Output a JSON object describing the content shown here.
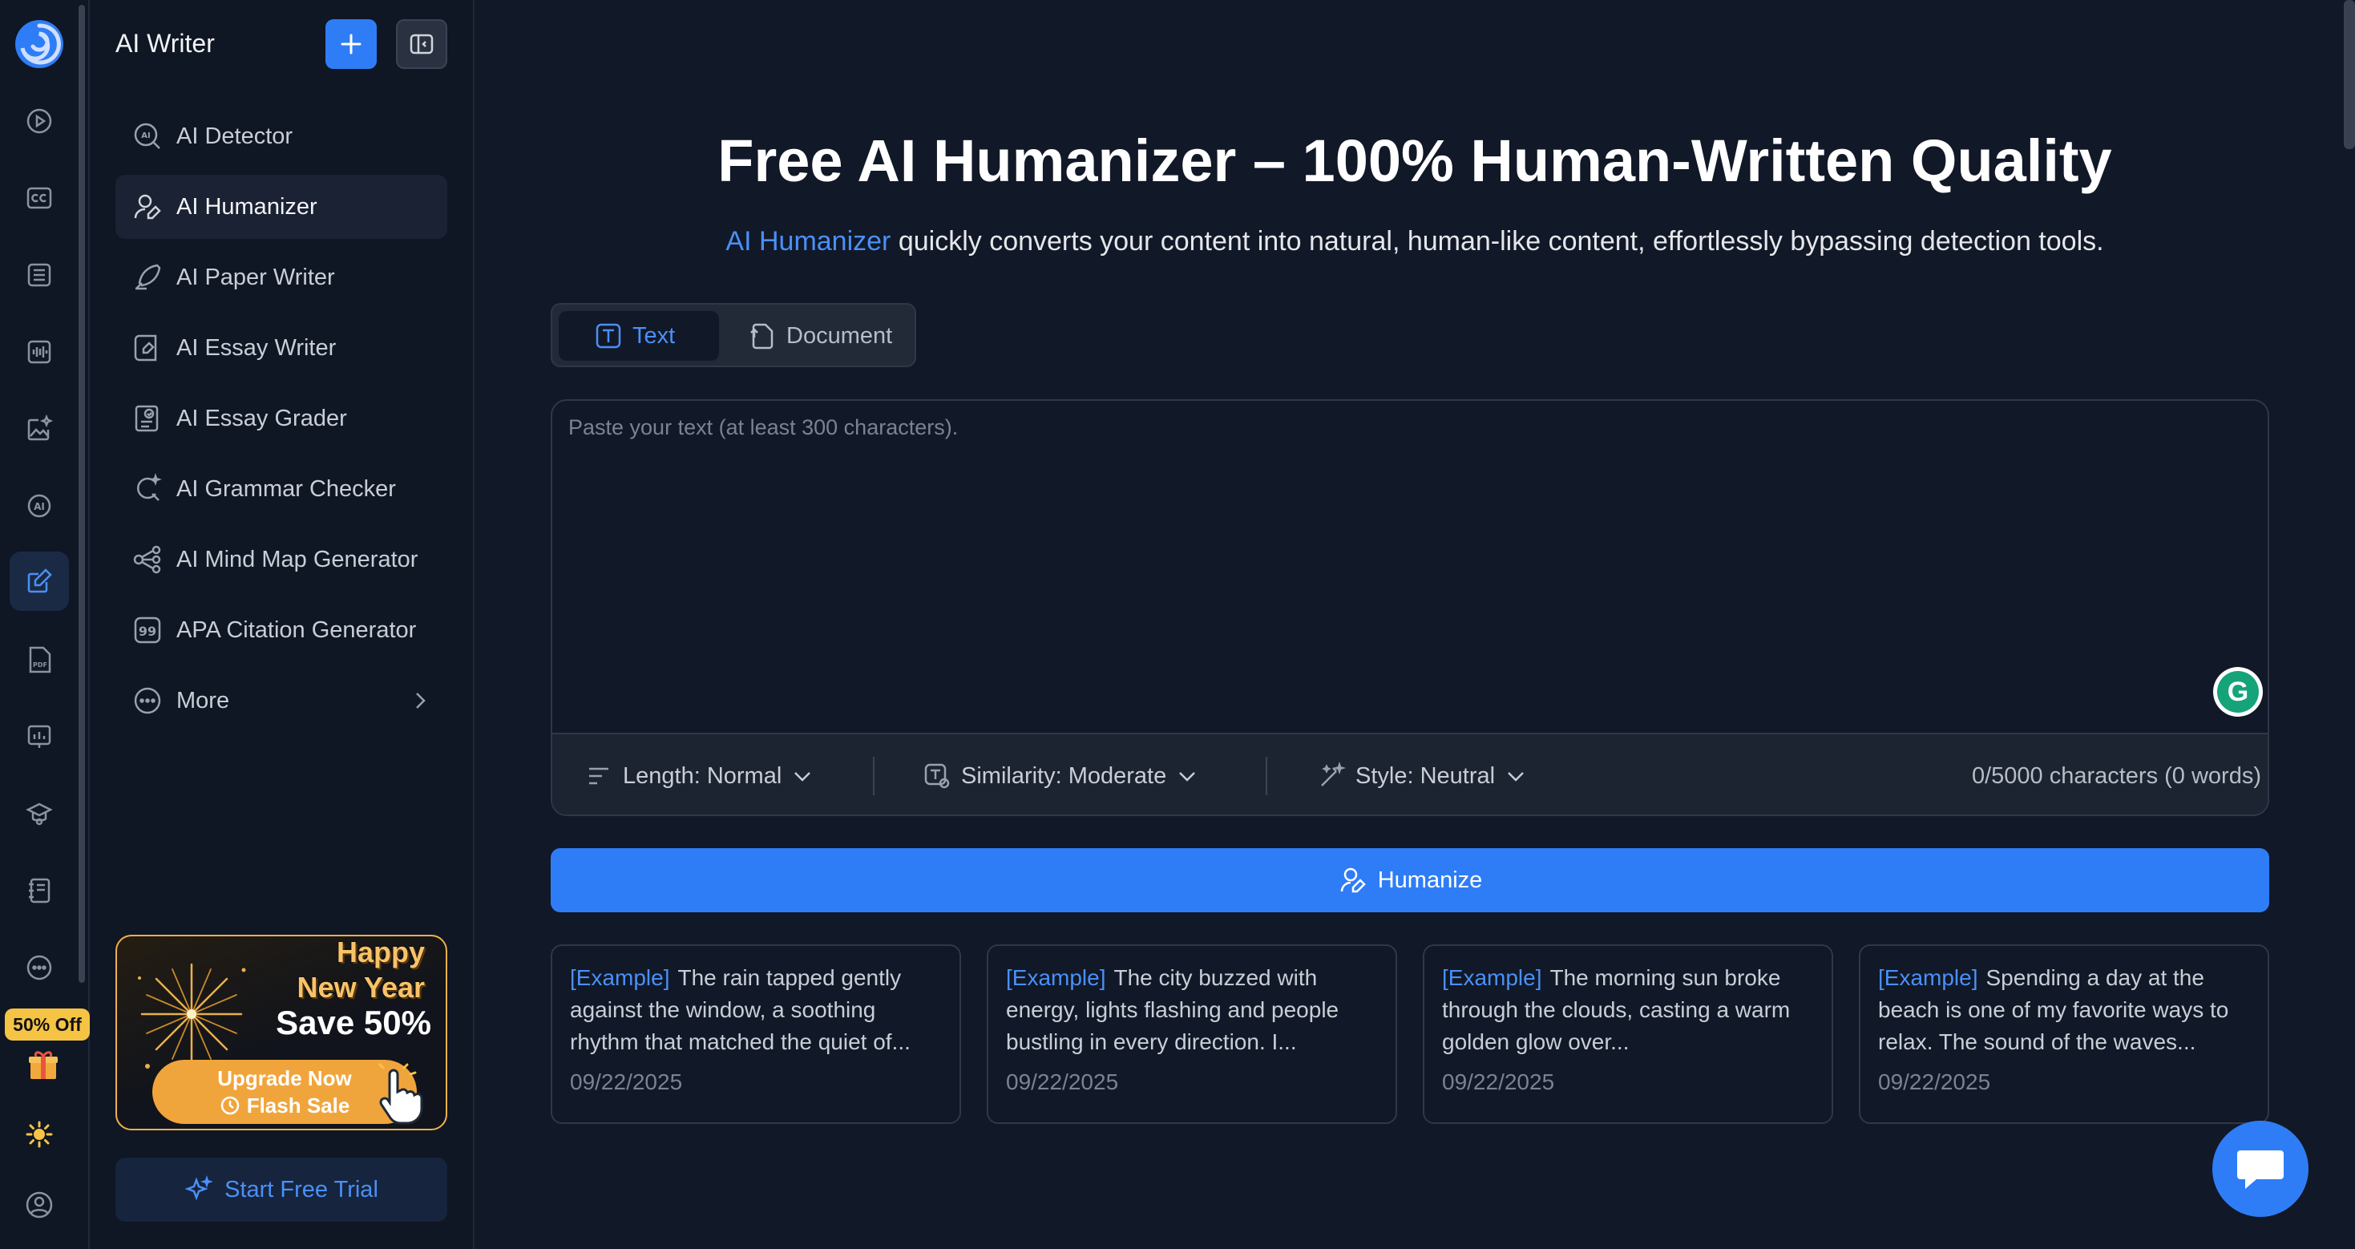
{
  "colors": {
    "accent": "#2f7df6",
    "accent_text": "#4a90f7",
    "background": "#111827",
    "panel": "#0f1624",
    "promo_gold": "#f0a53c",
    "badge_yellow": "#f6c445"
  },
  "rail": {
    "icons": [
      "logo-icon",
      "video-icon",
      "caption-icon",
      "list-icon",
      "audio-icon",
      "image-edit-icon",
      "ai-chat-icon",
      "pen-icon",
      "pdf-icon",
      "presentation-icon",
      "graduation-icon",
      "notebook-icon",
      "more-icon",
      "gift-icon",
      "sun-icon",
      "user-icon"
    ],
    "active": "pen-icon",
    "badge": "50% Off"
  },
  "sidebar": {
    "title": "AI Writer",
    "items": [
      {
        "label": "AI Detector",
        "icon": "ai-scan-icon"
      },
      {
        "label": "AI Humanizer",
        "icon": "user-pen-icon",
        "active": true
      },
      {
        "label": "AI Paper Writer",
        "icon": "quill-icon"
      },
      {
        "label": "AI Essay Writer",
        "icon": "essay-icon"
      },
      {
        "label": "AI Essay Grader",
        "icon": "grade-icon"
      },
      {
        "label": "AI Grammar Checker",
        "icon": "grammar-icon"
      },
      {
        "label": "AI Mind Map Generator",
        "icon": "mindmap-icon"
      },
      {
        "label": "APA Citation Generator",
        "icon": "quote-icon"
      },
      {
        "label": "More",
        "icon": "more-icon"
      }
    ],
    "promo": {
      "line1": "Happy",
      "line2": "New Year",
      "save": "Save 50%",
      "cta_line1": "Upgrade Now",
      "cta_line2": "Flash Sale"
    },
    "trial_button": "Start Free Trial"
  },
  "main": {
    "title": "Free AI Humanizer – 100% Human-Written Quality",
    "subtitle_accent": "AI Humanizer",
    "subtitle_rest": " quickly converts your content into natural, human-like content, effortlessly bypassing detection tools.",
    "tabs": [
      {
        "label": "Text",
        "active": true
      },
      {
        "label": "Document",
        "active": false
      }
    ],
    "editor": {
      "placeholder": "Paste your text (at least 300 characters).",
      "value": ""
    },
    "options": {
      "length": "Length: Normal",
      "similarity": "Similarity: Moderate",
      "style": "Style: Neutral"
    },
    "counter": "0/5000 characters (0 words)",
    "humanize_button": "Humanize",
    "examples": [
      {
        "tag": "[Example]",
        "text": "The rain tapped gently against the window, a soothing rhythm that matched the quiet of...",
        "date": "09/22/2025"
      },
      {
        "tag": "[Example]",
        "text": "The city buzzed with energy, lights flashing and people bustling in every direction. I...",
        "date": "09/22/2025"
      },
      {
        "tag": "[Example]",
        "text": "The morning sun broke through the clouds, casting a warm golden glow over...",
        "date": "09/22/2025"
      },
      {
        "tag": "[Example]",
        "text": "Spending a day at the beach is one of my favorite ways to relax. The sound of the waves...",
        "date": "09/22/2025"
      }
    ]
  }
}
